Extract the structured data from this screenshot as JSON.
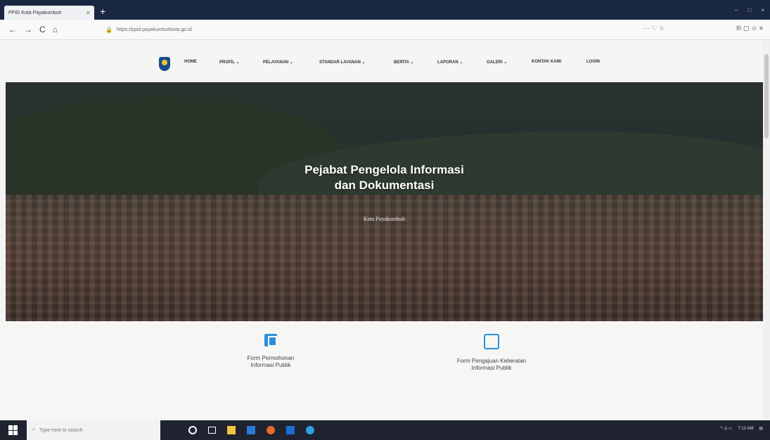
{
  "browser": {
    "tab_title": "PPID Kota Payakumbuh",
    "tab_close": "×",
    "new_tab": "+",
    "back": "←",
    "forward": "→",
    "reload": "C",
    "home": "⌂",
    "url": "https://ppid.payakumbuhkota.go.id",
    "url_extras": "··· ♡ ☆",
    "tool_extras": "II\\ ▢ ☺ ≡",
    "window_controls": [
      "–",
      "□",
      "×"
    ]
  },
  "site": {
    "nav": [
      "HOME",
      "PROFIL ⌄",
      "PELAYANAN ⌄",
      "STANDAR LAYANAN ⌄",
      "BERITA ⌄",
      "LAPORAN ⌄",
      "GALERI ⌄",
      "KONTAK KAMI",
      "LOGIN"
    ]
  },
  "hero": {
    "title_line1": "Pejabat Pengelola Informasi",
    "title_line2": "dan Dokumentasi",
    "subtitle": "Kota Payakumbuh"
  },
  "forms": [
    {
      "label_line1": "Form Permohonan",
      "label_line2": "Informasi Publik",
      "icon": "document-filled-icon"
    },
    {
      "label_line1": "Form Pengajuan Keberatan",
      "label_line2": "Informasi Publik",
      "icon": "document-outline-icon"
    }
  ],
  "taskbar": {
    "search_placeholder": "Type here to search",
    "time": "7:12 AM"
  },
  "colors": {
    "accent": "#2b8fd9",
    "tabstrip": "#1a2740",
    "taskbar": "#1f2330"
  }
}
